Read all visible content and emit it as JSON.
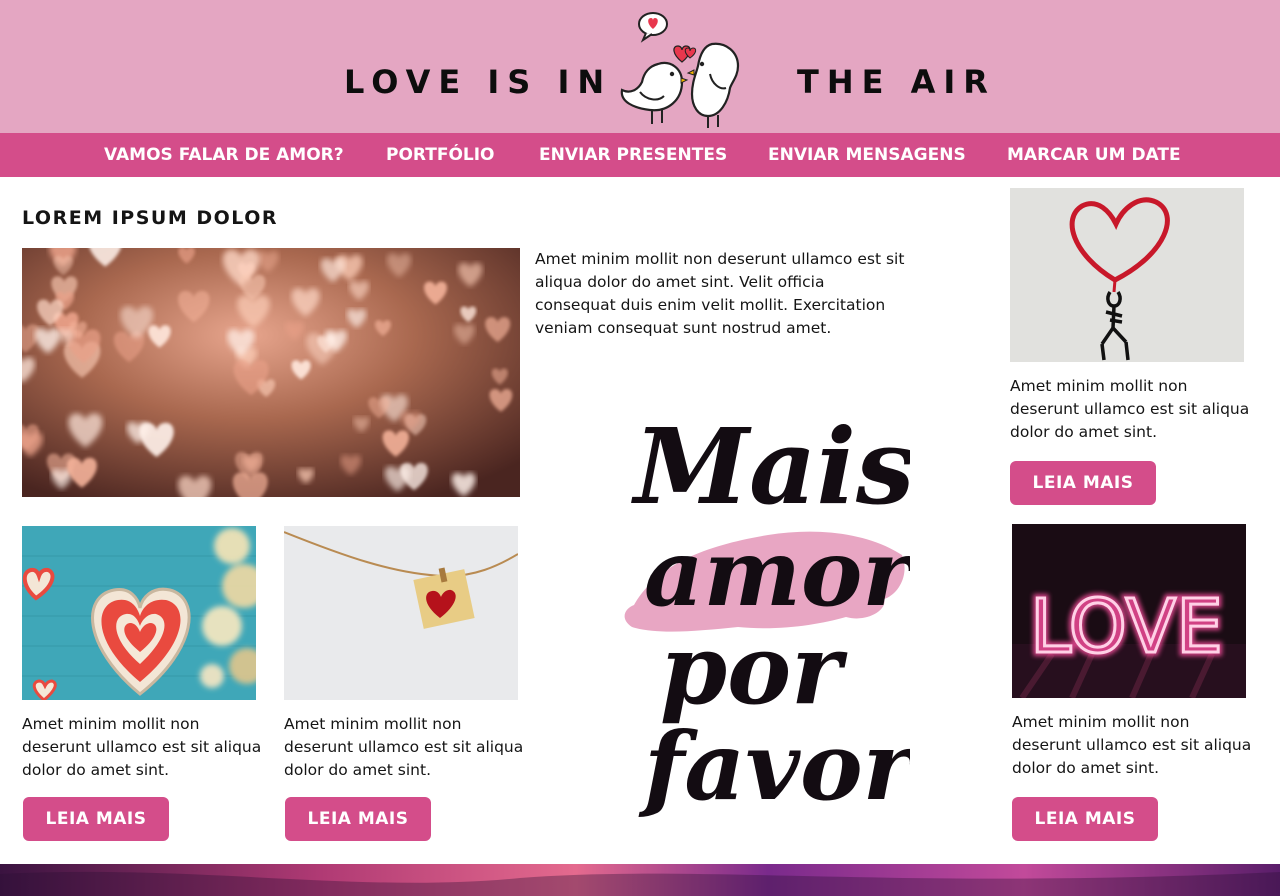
{
  "header": {
    "brand_left": "LOVE IS IN",
    "brand_right": "THE AIR",
    "logo_icon": "kissing-birds-icon"
  },
  "nav": {
    "items": [
      {
        "label": "VAMOS FALAR DE AMOR?"
      },
      {
        "label": "PORTFÓLIO"
      },
      {
        "label": "ENVIAR PRESENTES"
      },
      {
        "label": "ENVIAR MENSAGENS"
      },
      {
        "label": "MARCAR UM DATE"
      }
    ]
  },
  "main": {
    "title": "LOREM IPSUM DOLOR",
    "intro_text": "Amet minim mollit non deserunt ullamco est sit aliqua dolor do amet sint. Velit officia consequat duis enim velit mollit. Exercitation veniam consequat sunt nostrud amet.",
    "cards": [
      {
        "text": "Amet minim mollit non deserunt ullamco est sit aliqua dolor do amet sint.",
        "button": "LEIA MAIS"
      },
      {
        "text": "Amet minim mollit non deserunt ullamco est sit aliqua dolor do amet sint.",
        "button": "LEIA MAIS"
      }
    ],
    "lettering": [
      "Mais",
      "amor",
      "por",
      "favor"
    ]
  },
  "sidebar": {
    "cards": [
      {
        "text": "Amet minim mollit non deserunt ullamco est sit aliqua dolor do amet sint.",
        "button": "LEIA MAIS"
      },
      {
        "text": "Amet minim mollit non deserunt ullamco est sit aliqua dolor do amet sint.",
        "button": "LEIA MAIS"
      }
    ],
    "neon_word": "LOVE"
  },
  "colors": {
    "header_bg": "#e4a6c2",
    "nav_bg": "#d44d8a",
    "button_bg": "#d44d8a"
  }
}
